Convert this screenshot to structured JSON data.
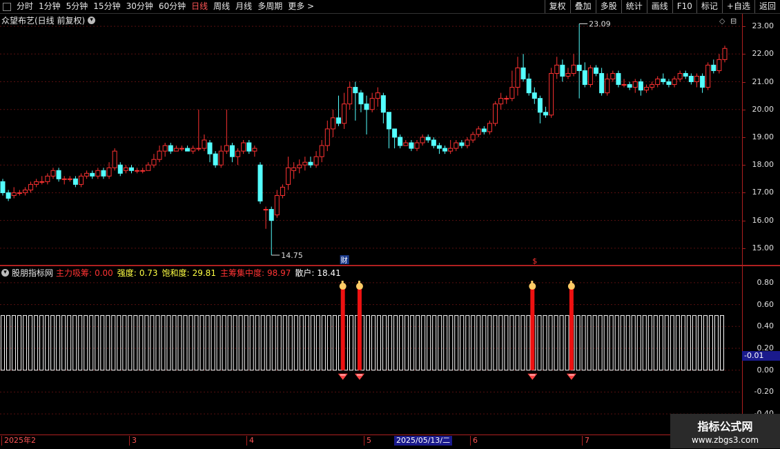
{
  "toolbar": {
    "periods": [
      "分时",
      "1分钟",
      "5分钟",
      "15分钟",
      "30分钟",
      "60分钟",
      "日线",
      "周线",
      "月线",
      "多周期",
      "更多 >"
    ],
    "active_period": "日线",
    "buttons": [
      "复权",
      "叠加",
      "多股",
      "统计",
      "画线",
      "F10",
      "标记",
      "+自选",
      "返回"
    ]
  },
  "chart_title": "众望布艺(日线 前复权)",
  "indicator": {
    "name": "股朋指标网",
    "fields": [
      {
        "label": "主力吸筹:",
        "value": "0.00",
        "color": "#ff3333"
      },
      {
        "label": "强度:",
        "value": "0.73",
        "color": "#ffff44"
      },
      {
        "label": "饱和度:",
        "value": "29.81",
        "color": "#ffff44"
      },
      {
        "label": "主筹集中度:",
        "value": "98.97",
        "color": "#ff3333"
      },
      {
        "label": "散户:",
        "value": "18.41",
        "color": "#ffffff"
      }
    ],
    "current_value": "-0.01"
  },
  "price_axis": [
    "23.00",
    "22.00",
    "21.00",
    "20.00",
    "19.00",
    "18.00",
    "17.00",
    "16.00",
    "15.00"
  ],
  "indicator_axis": [
    "0.80",
    "0.60",
    "0.40",
    "0.20",
    "0.00",
    "-0.20",
    "-0.40"
  ],
  "annotations": {
    "high": "23.09",
    "low": "14.75",
    "cai": "财",
    "dollar": "$"
  },
  "dates": {
    "start": "2025年2",
    "months": [
      "3",
      "4",
      "5",
      "6",
      "7"
    ],
    "selected": "2025/05/13/二"
  },
  "watermark": {
    "line1": "指标公式网",
    "line2": "www.zbgs3.com"
  },
  "chart_data": {
    "type": "candlestick",
    "ylim": [
      14.6,
      23.3
    ],
    "candles": [
      [
        17.4,
        17.0,
        17.5,
        16.9
      ],
      [
        17.0,
        16.8,
        17.1,
        16.7
      ],
      [
        16.9,
        17.0,
        17.2,
        16.8
      ],
      [
        17.0,
        17.0,
        17.1,
        16.9
      ],
      [
        17.0,
        17.1,
        17.2,
        16.9
      ],
      [
        17.1,
        17.3,
        17.4,
        17.0
      ],
      [
        17.3,
        17.4,
        17.5,
        17.2
      ],
      [
        17.4,
        17.4,
        17.6,
        17.3
      ],
      [
        17.4,
        17.6,
        17.7,
        17.3
      ],
      [
        17.6,
        17.8,
        17.9,
        17.5
      ],
      [
        17.8,
        17.5,
        17.9,
        17.4
      ],
      [
        17.5,
        17.5,
        17.6,
        17.3
      ],
      [
        17.5,
        17.5,
        17.6,
        17.4
      ],
      [
        17.5,
        17.3,
        17.6,
        17.2
      ],
      [
        17.3,
        17.6,
        17.7,
        17.2
      ],
      [
        17.6,
        17.7,
        17.8,
        17.5
      ],
      [
        17.7,
        17.6,
        17.8,
        17.5
      ],
      [
        17.6,
        17.8,
        17.9,
        17.5
      ],
      [
        17.8,
        17.6,
        17.9,
        17.5
      ],
      [
        17.6,
        17.9,
        18.1,
        17.5
      ],
      [
        17.9,
        18.5,
        18.6,
        17.8
      ],
      [
        18.0,
        17.7,
        18.1,
        17.6
      ],
      [
        17.8,
        17.9,
        18.0,
        17.7
      ],
      [
        17.9,
        17.8,
        18.0,
        17.7
      ],
      [
        17.8,
        17.8,
        17.9,
        17.7
      ],
      [
        17.8,
        17.8,
        17.9,
        17.7
      ],
      [
        17.8,
        18.0,
        18.1,
        17.8
      ],
      [
        18.0,
        18.2,
        18.4,
        17.9
      ],
      [
        18.2,
        18.5,
        18.7,
        18.1
      ],
      [
        18.5,
        18.7,
        18.8,
        18.3
      ],
      [
        18.7,
        18.5,
        18.8,
        18.4
      ],
      [
        18.5,
        18.6,
        18.7,
        18.5
      ],
      [
        18.6,
        18.6,
        18.7,
        18.5
      ],
      [
        18.6,
        18.5,
        18.7,
        18.5
      ],
      [
        18.5,
        18.6,
        18.7,
        18.4
      ],
      [
        18.6,
        18.6,
        20.0,
        18.5
      ],
      [
        18.6,
        18.9,
        19.1,
        18.5
      ],
      [
        18.8,
        18.4,
        18.9,
        18.1
      ],
      [
        18.4,
        18.0,
        18.5,
        17.9
      ],
      [
        18.0,
        18.5,
        18.7,
        17.9
      ],
      [
        18.5,
        18.7,
        20.0,
        18.4
      ],
      [
        18.7,
        18.3,
        18.8,
        18.1
      ],
      [
        18.3,
        18.5,
        18.6,
        18.0
      ],
      [
        18.5,
        18.8,
        18.9,
        18.4
      ],
      [
        18.8,
        18.5,
        18.9,
        18.4
      ],
      [
        18.5,
        18.6,
        18.7,
        18.3
      ],
      [
        18.0,
        16.7,
        18.1,
        16.6
      ],
      [
        16.4,
        16.4,
        16.5,
        15.7
      ],
      [
        16.4,
        16.0,
        16.5,
        14.75
      ],
      [
        16.2,
        16.9,
        17.1,
        16.1
      ],
      [
        16.9,
        17.2,
        17.3,
        16.8
      ],
      [
        17.3,
        17.9,
        18.3,
        17.1
      ],
      [
        17.8,
        17.9,
        18.1,
        17.5
      ],
      [
        17.9,
        18.0,
        18.2,
        17.7
      ],
      [
        18.0,
        18.1,
        18.3,
        17.8
      ],
      [
        18.1,
        18.0,
        18.3,
        17.9
      ],
      [
        18.0,
        18.3,
        18.5,
        17.9
      ],
      [
        18.3,
        18.7,
        18.9,
        18.1
      ],
      [
        18.7,
        19.3,
        19.6,
        18.5
      ],
      [
        19.3,
        19.7,
        20.0,
        19.0
      ],
      [
        19.7,
        19.5,
        20.5,
        19.4
      ],
      [
        19.5,
        20.2,
        20.6,
        19.3
      ],
      [
        20.2,
        20.8,
        21.0,
        20.0
      ],
      [
        20.8,
        20.6,
        21.0,
        19.6
      ],
      [
        20.6,
        20.2,
        20.7,
        19.9
      ],
      [
        20.2,
        20.0,
        20.5,
        19.1
      ],
      [
        20.0,
        20.4,
        20.6,
        19.9
      ],
      [
        20.4,
        20.6,
        20.8,
        20.1
      ],
      [
        20.5,
        19.9,
        20.6,
        19.5
      ],
      [
        19.9,
        19.3,
        19.9,
        18.6
      ],
      [
        19.3,
        19.0,
        19.3,
        18.6
      ],
      [
        19.0,
        18.7,
        19.1,
        18.6
      ],
      [
        18.7,
        18.8,
        18.9,
        18.7
      ],
      [
        18.8,
        18.6,
        18.9,
        18.5
      ],
      [
        18.6,
        18.8,
        18.9,
        18.5
      ],
      [
        18.8,
        19.0,
        19.1,
        18.7
      ],
      [
        19.0,
        18.9,
        19.1,
        18.8
      ],
      [
        18.9,
        18.7,
        19.0,
        18.6
      ],
      [
        18.7,
        18.6,
        18.8,
        18.4
      ],
      [
        18.6,
        18.5,
        18.7,
        18.4
      ],
      [
        18.5,
        18.6,
        18.9,
        18.4
      ],
      [
        18.6,
        18.8,
        18.9,
        18.5
      ],
      [
        18.8,
        18.7,
        18.9,
        18.6
      ],
      [
        18.7,
        18.9,
        19.0,
        18.6
      ],
      [
        18.9,
        19.1,
        19.2,
        18.8
      ],
      [
        19.1,
        19.3,
        19.4,
        19.0
      ],
      [
        19.3,
        19.2,
        19.4,
        19.1
      ],
      [
        19.2,
        19.5,
        19.6,
        19.1
      ],
      [
        19.5,
        20.2,
        20.3,
        19.4
      ],
      [
        20.2,
        20.4,
        20.6,
        20.0
      ],
      [
        20.4,
        20.4,
        20.5,
        20.2
      ],
      [
        20.4,
        20.8,
        21.4,
        20.3
      ],
      [
        20.8,
        21.5,
        21.9,
        20.5
      ],
      [
        21.5,
        21.1,
        22.0,
        21.0
      ],
      [
        21.1,
        20.6,
        21.3,
        20.5
      ],
      [
        20.6,
        20.4,
        20.8,
        20.2
      ],
      [
        20.4,
        19.9,
        20.5,
        19.5
      ],
      [
        19.9,
        19.8,
        20.1,
        19.7
      ],
      [
        19.8,
        21.3,
        21.5,
        19.7
      ],
      [
        21.3,
        21.6,
        21.9,
        21.1
      ],
      [
        21.6,
        21.2,
        21.8,
        21.0
      ],
      [
        21.2,
        21.3,
        21.5,
        21.1
      ],
      [
        21.3,
        21.6,
        22.0,
        21.2
      ],
      [
        21.6,
        21.4,
        23.09,
        20.4
      ],
      [
        21.4,
        20.9,
        21.7,
        20.8
      ],
      [
        20.9,
        21.5,
        21.6,
        20.8
      ],
      [
        21.5,
        21.3,
        21.6,
        21.2
      ],
      [
        21.3,
        20.6,
        21.5,
        20.5
      ],
      [
        20.6,
        21.1,
        21.3,
        20.5
      ],
      [
        21.1,
        21.3,
        21.4,
        21.0
      ],
      [
        21.3,
        20.9,
        21.4,
        20.8
      ],
      [
        20.9,
        20.9,
        21.1,
        20.8
      ],
      [
        20.9,
        20.8,
        21.0,
        20.7
      ],
      [
        20.8,
        21.0,
        21.1,
        20.6
      ],
      [
        21.0,
        20.7,
        21.1,
        20.5
      ],
      [
        20.7,
        20.8,
        20.9,
        20.6
      ],
      [
        20.8,
        20.9,
        21.0,
        20.7
      ],
      [
        20.9,
        21.1,
        21.2,
        20.8
      ],
      [
        21.1,
        21.0,
        21.3,
        20.9
      ],
      [
        21.0,
        20.9,
        21.1,
        20.8
      ],
      [
        20.9,
        21.1,
        21.2,
        20.8
      ],
      [
        21.1,
        21.3,
        21.4,
        21.0
      ],
      [
        21.3,
        21.2,
        21.4,
        21.1
      ],
      [
        21.2,
        21.0,
        21.3,
        20.9
      ],
      [
        21.0,
        21.2,
        21.3,
        20.8
      ],
      [
        21.2,
        20.8,
        21.3,
        20.6
      ],
      [
        20.8,
        21.6,
        21.7,
        20.7
      ],
      [
        21.6,
        21.4,
        21.8,
        21.3
      ],
      [
        21.4,
        21.8,
        22.0,
        21.3
      ],
      [
        21.8,
        22.2,
        22.3,
        21.7
      ]
    ],
    "indicator_bars": {
      "count": 131,
      "height": 0.5,
      "red_signal_indices": [
        61,
        64,
        95,
        102
      ],
      "red_signal_value": 0.78
    }
  }
}
